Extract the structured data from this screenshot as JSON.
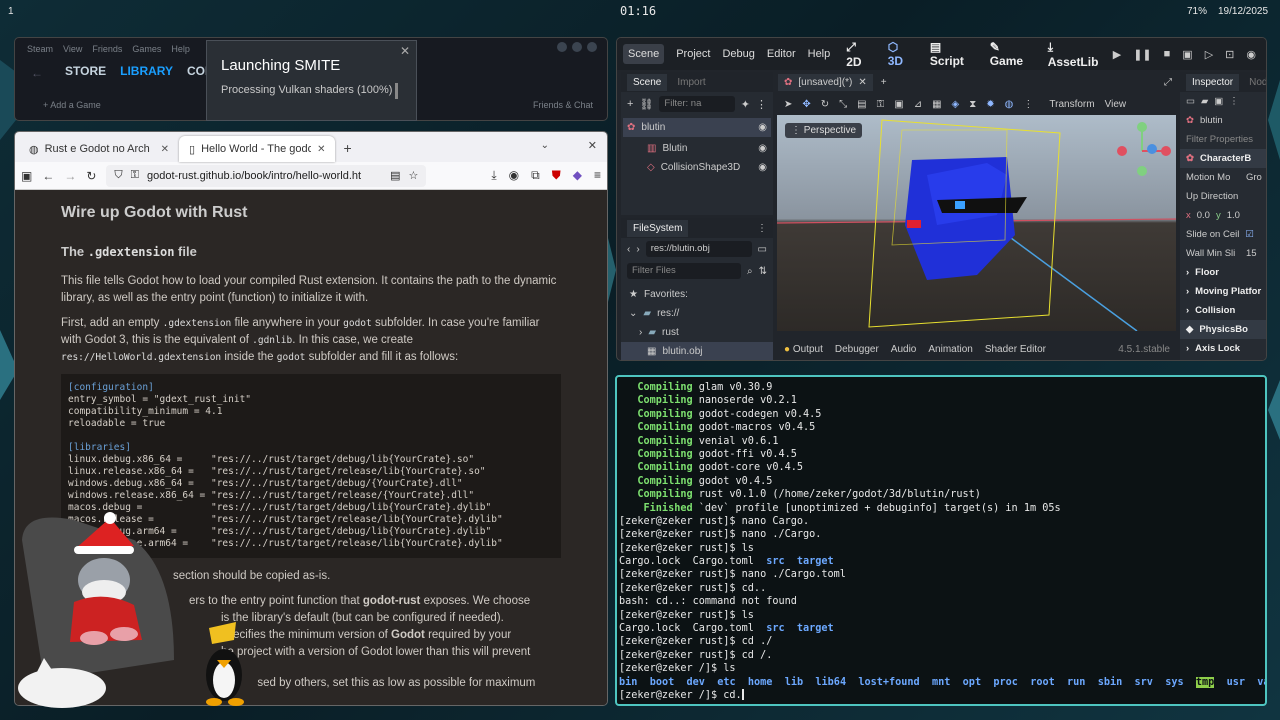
{
  "topbar": {
    "workspace": "1",
    "clock": "01:16",
    "battery": "71%",
    "date": "19/12/2025"
  },
  "steam": {
    "menu": [
      "Steam",
      "View",
      "Friends",
      "Games",
      "Help"
    ],
    "tabs": [
      "STORE",
      "LIBRARY",
      "COM"
    ],
    "active_tab": "LIBRARY",
    "add_game": "Add a Game",
    "friends": "Friends & Chat"
  },
  "launch": {
    "title": "Launching SMITE",
    "status": "Processing Vulkan shaders (100%)"
  },
  "firefox": {
    "tabs": [
      {
        "title": "Rust e Godot no Arch"
      },
      {
        "title": "Hello World - The godot"
      }
    ],
    "url": "godot-rust.github.io/book/intro/hello-world.ht",
    "page": {
      "h1": "Wire up Godot with Rust",
      "h2_pre": "The ",
      "h2_code": ".gdextension",
      "h2_post": " file",
      "p1": "This file tells Godot how to load your compiled Rust extension. It contains the path to the dynamic library, as well as the entry point (function) to initialize it with.",
      "p2a": "First, add an empty ",
      "p2b": ".gdextension",
      "p2c": " file anywhere in your ",
      "p2d": "godot",
      "p2e": " subfolder. In case you're familiar with Godot 3, this is the equivalent of ",
      "p2f": ".gdnlib",
      "p2g": ". In this case, we create ",
      "p2h": "res://HelloWorld.gdextension",
      "p2i": " inside the ",
      "p2j": "godot",
      "p2k": " subfolder and fill it as follows:",
      "code": [
        {
          "t": "h",
          "v": "[configuration]"
        },
        {
          "t": "n",
          "v": "entry_symbol = \"gdext_rust_init\""
        },
        {
          "t": "n",
          "v": "compatibility_minimum = 4.1"
        },
        {
          "t": "n",
          "v": "reloadable = true"
        },
        {
          "t": "n",
          "v": ""
        },
        {
          "t": "h",
          "v": "[libraries]"
        },
        {
          "t": "n",
          "v": "linux.debug.x86_64 =     \"res://../rust/target/debug/lib{YourCrate}.so\""
        },
        {
          "t": "n",
          "v": "linux.release.x86_64 =   \"res://../rust/target/release/lib{YourCrate}.so\""
        },
        {
          "t": "n",
          "v": "windows.debug.x86_64 =   \"res://../rust/target/debug/{YourCrate}.dll\""
        },
        {
          "t": "n",
          "v": "windows.release.x86_64 = \"res://../rust/target/release/{YourCrate}.dll\""
        },
        {
          "t": "n",
          "v": "macos.debug =            \"res://../rust/target/debug/lib{YourCrate}.dylib\""
        },
        {
          "t": "n",
          "v": "macos.release =          \"res://../rust/target/release/lib{YourCrate}.dylib\""
        },
        {
          "t": "n",
          "v": "macos.debug.arm64 =      \"res://../rust/target/debug/lib{YourCrate}.dylib\""
        },
        {
          "t": "n",
          "v": "macos.release.arm64 =    \"res://../rust/target/release/lib{YourCrate}.dylib\""
        }
      ],
      "p3": "section should be copied as-is.",
      "p4a": "ers to the entry point function that ",
      "p4b": "godot-rust",
      "p4c": " exposes. We choose",
      "p5": "is the library's default (but can be configured if needed).",
      "p6a": "specifies the minimum version of ",
      "p6b": "Godot",
      "p6c": " required by your",
      "p7": "he project with a version of Godot lower than this will prevent",
      "p8": "p          sed by others, set this as low as possible for maximum"
    }
  },
  "godot": {
    "menu": [
      "Scene",
      "Project",
      "Debug",
      "Editor",
      "Help"
    ],
    "workspaces": [
      "2D",
      "3D",
      "Script",
      "Game",
      "AssetLib"
    ],
    "scene_tabs": [
      "Scene",
      "Import"
    ],
    "filter_placeholder": "Filter: na",
    "tree": [
      "blutin",
      "Blutin",
      "CollisionShape3D"
    ],
    "editor_tab": "[unsaved](*)",
    "toolbar": [
      "Transform",
      "View"
    ],
    "perspective": "Perspective",
    "filesystem": {
      "title": "FileSystem",
      "path": "res://blutin.obj",
      "filter": "Filter Files",
      "favorites": "Favorites:",
      "items": [
        "res://",
        "rust",
        "blutin.obj"
      ]
    },
    "bottom_tabs": [
      "Output",
      "Debugger",
      "Audio",
      "Animation",
      "Shader Editor"
    ],
    "version": "4.5.1.stable",
    "inspector": {
      "tabs": [
        "Inspector",
        "Node"
      ],
      "node": "blutin",
      "filter": "Filter Properties",
      "class": "CharacterB",
      "rows": [
        "Motion Mo",
        "Up Direction"
      ],
      "motion_val": "Gro",
      "x": "0.0",
      "y": "1.0",
      "slide": "Slide on Ceil",
      "wall": "Wall Min Sli",
      "wall_val": "15",
      "sections": [
        "Floor",
        "Moving Platfor",
        "Collision"
      ],
      "physics": "PhysicsBo",
      "axis": "Axis Lock"
    }
  },
  "terminal": {
    "compiling": [
      [
        "Compiling",
        "glam v0.30.9"
      ],
      [
        "Compiling",
        "nanoserde v0.2.1"
      ],
      [
        "Compiling",
        "godot-codegen v0.4.5"
      ],
      [
        "Compiling",
        "godot-macros v0.4.5"
      ],
      [
        "Compiling",
        "venial v0.6.1"
      ],
      [
        "Compiling",
        "godot-ffi v0.4.5"
      ],
      [
        "Compiling",
        "godot-core v0.4.5"
      ],
      [
        "Compiling",
        "godot v0.4.5"
      ],
      [
        "Compiling",
        "rust v0.1.0 (/home/zeker/godot/3d/blutin/rust)"
      ],
      [
        "Finished",
        "`dev` profile [unoptimized + debuginfo] target(s) in 1m 05s"
      ]
    ],
    "lines": [
      "[zeker@zeker rust]$ nano Cargo.",
      "[zeker@zeker rust]$ nano ./Cargo.",
      "[zeker@zeker rust]$ ls",
      "LS1",
      "[zeker@zeker rust]$ nano ./Cargo.toml",
      "[zeker@zeker rust]$ cd..",
      "bash: cd..: command not found",
      "[zeker@zeker rust]$ ls",
      "LS1",
      "[zeker@zeker rust]$ cd ./",
      "[zeker@zeker rust]$ cd /.",
      "[zeker@zeker /]$ ls",
      "LS2",
      "PROMPT"
    ],
    "ls1_files": [
      "Cargo.lock",
      "Cargo.toml"
    ],
    "ls1_dirs": [
      "src",
      "target"
    ],
    "ls2": [
      "bin",
      "boot",
      "dev",
      "etc",
      "home",
      "lib",
      "lib64",
      "lost+found",
      "mnt",
      "opt",
      "proc",
      "root",
      "run",
      "sbin",
      "srv",
      "sys",
      "tmp",
      "usr",
      "var"
    ],
    "ls2_highlight": "tmp",
    "prompt": "[zeker@zeker /]$ ",
    "input": "cd."
  }
}
